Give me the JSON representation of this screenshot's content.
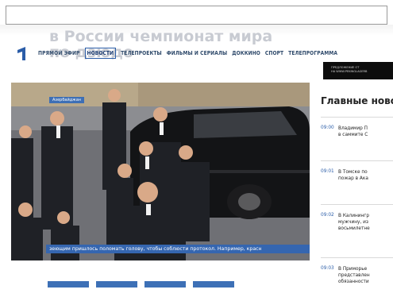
{
  "header": {
    "ghost_title": "в России чемпионат мира\nпо дзюдо",
    "nav": [
      "ПРЯМОЙ ЭФИР",
      "НОВОСТИ",
      "ТЕЛЕПРОЕКТЫ",
      "ФИЛЬМЫ И СЕРИАЛЫ",
      "ДОККИНО",
      "СПОРТ",
      "ТЕЛЕПРОГРАММА"
    ],
    "active_nav": "НОВОСТИ",
    "ad_line1": "ПРЕДЛОЖЕНИЕ ОТ",
    "ad_line2": "НА WWW.PEKINGLAGERB"
  },
  "video": {
    "badge": "Азербайджан",
    "subtitle": "зеющим пришлось поломать голову, чтобы соблюсти протокол.  Например, красн"
  },
  "news": {
    "heading": "Главные ново",
    "items": [
      {
        "time": "09:00",
        "text": "Владимир П\nв саммите С"
      },
      {
        "time": "09:01",
        "text": "В Томске по\nпожар в Ака"
      },
      {
        "time": "09:02",
        "text": "В Калинингр\nмужчину, из\nвосьмилетне"
      },
      {
        "time": "09:03",
        "text": "В Приморье\nпредставлен\nобязанности"
      }
    ]
  },
  "colors": {
    "brand_blue": "#2b5da8",
    "nav_text": "#2f4a6b",
    "accent_bar": "#3d70b6"
  }
}
